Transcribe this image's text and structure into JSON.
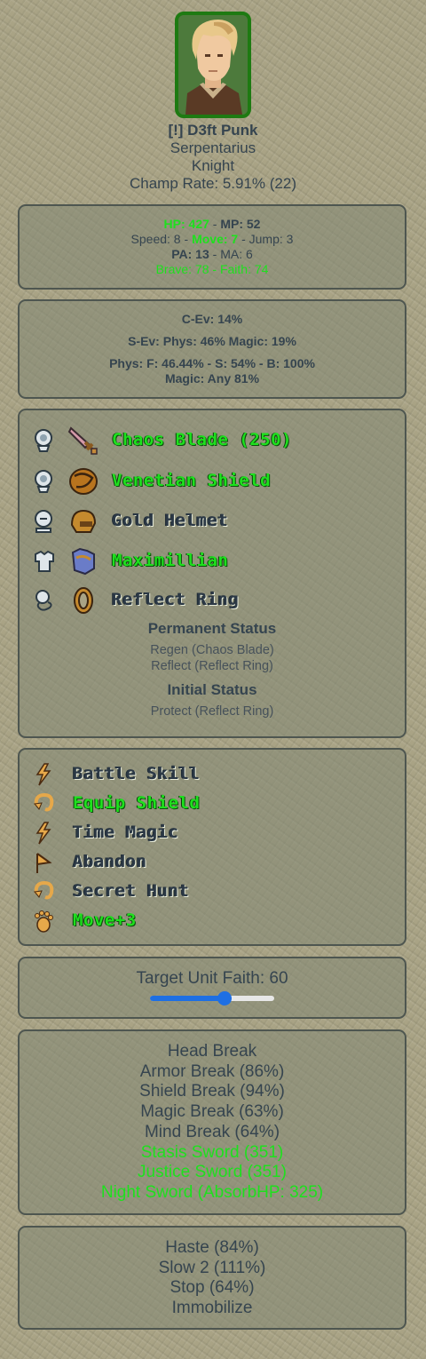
{
  "unit": {
    "name": "[!] D3ft Punk",
    "sign": "Serpentarius",
    "job": "Knight",
    "champ_rate": "Champ Rate: 5.91% (22)"
  },
  "stats": {
    "hp": "HP: 427",
    "mp": "MP: 52",
    "speed": "Speed: 8",
    "move": "Move: 7",
    "jump": "Jump: 3",
    "pa": "PA: 13",
    "ma": "MA: 6",
    "brave": "Brave: 78",
    "faith": "Faith: 74",
    "sep": " - "
  },
  "evasion": {
    "c_ev": "C-Ev: 14%",
    "s_ev": "S-Ev: Phys: 46% Magic: 19%",
    "phys": "Phys: F: 46.44% - S: 54% - B: 100%",
    "magic": "Magic: Any 81%"
  },
  "equipment": [
    {
      "slot_icon": "weapon-slot-icon",
      "item_icon": "sword-icon",
      "label": "Chaos Blade (250)",
      "highlight": true
    },
    {
      "slot_icon": "shield-slot-icon",
      "item_icon": "shield-icon",
      "label": "Venetian Shield",
      "highlight": true
    },
    {
      "slot_icon": "head-slot-icon",
      "item_icon": "helmet-icon",
      "label": "Gold Helmet",
      "highlight": false
    },
    {
      "slot_icon": "body-slot-icon",
      "item_icon": "armor-icon",
      "label": "Maximillian",
      "highlight": true
    },
    {
      "slot_icon": "accessory-slot-icon",
      "item_icon": "ring-icon",
      "label": "Reflect Ring",
      "highlight": false
    }
  ],
  "permanent_status": {
    "title": "Permanent Status",
    "lines": [
      "Regen (Chaos Blade)",
      "Reflect (Reflect Ring)"
    ]
  },
  "initial_status": {
    "title": "Initial Status",
    "lines": [
      "Protect (Reflect Ring)"
    ]
  },
  "abilities": [
    {
      "icon": "lightning-icon",
      "label": "Battle Skill",
      "highlight": false
    },
    {
      "icon": "reaction-icon",
      "label": "Equip Shield",
      "highlight": true
    },
    {
      "icon": "lightning-icon",
      "label": "Time Magic",
      "highlight": false
    },
    {
      "icon": "support-icon",
      "label": "Abandon",
      "highlight": false
    },
    {
      "icon": "reaction-icon",
      "label": "Secret Hunt",
      "highlight": false
    },
    {
      "icon": "movement-icon",
      "label": "Move+3",
      "highlight": true
    }
  ],
  "target_faith": {
    "label": "Target Unit Faith: 60",
    "value": 60,
    "max": 100
  },
  "skills": [
    {
      "label": "Head Break",
      "highlight": false
    },
    {
      "label": "Armor Break (86%)",
      "highlight": false
    },
    {
      "label": "Shield Break (94%)",
      "highlight": false
    },
    {
      "label": "Magic Break (63%)",
      "highlight": false
    },
    {
      "label": "Mind Break (64%)",
      "highlight": false
    },
    {
      "label": "Stasis Sword (351)",
      "highlight": true
    },
    {
      "label": "Justice Sword (351)",
      "highlight": true
    },
    {
      "label": "Night Sword (AbsorbHP: 325)",
      "highlight": true
    }
  ],
  "time_spells": [
    {
      "label": "Haste (84%)"
    },
    {
      "label": "Slow 2 (111%)"
    },
    {
      "label": "Stop (64%)"
    },
    {
      "label": "Immobilize"
    }
  ],
  "colors": {
    "highlight": "#1ee01e",
    "text": "#35444f",
    "portrait_border": "#1e7a12",
    "slider": "#1e6fe3"
  }
}
